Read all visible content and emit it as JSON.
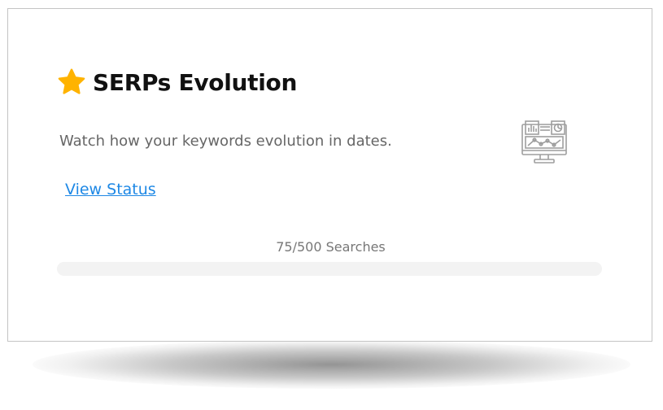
{
  "card": {
    "title": "SERPs Evolution",
    "description": "Watch how your keywords evolution in dates.",
    "link_label": "View Status",
    "progress_label": "75/500 Searches",
    "progress_fraction": 0.15,
    "icons": {
      "title": "star-icon",
      "illustration": "monitor-analytics-icon"
    }
  },
  "colors": {
    "star": "#FFB300",
    "link": "#1E88E5",
    "title": "#111111",
    "description": "#666666",
    "progress_track": "#F3F3F3",
    "border": "#C4C4C4"
  }
}
